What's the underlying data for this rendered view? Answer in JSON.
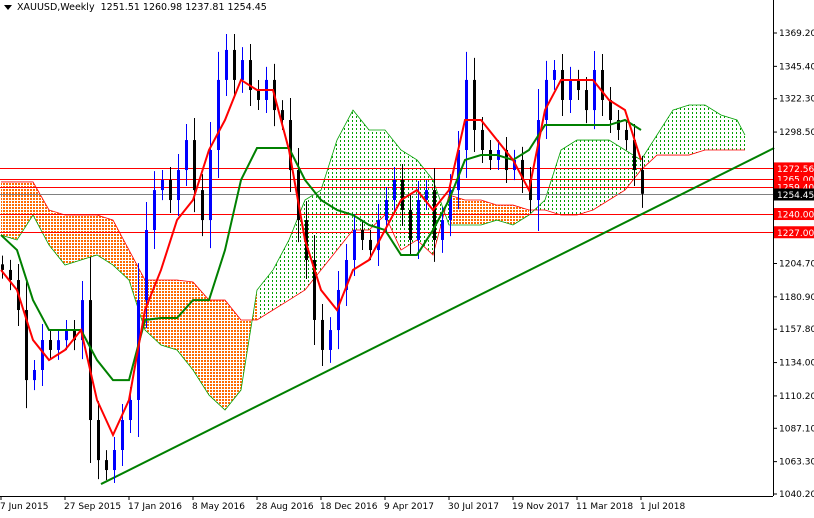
{
  "header": {
    "symbol": "XAUUSD,Weekly",
    "ohlc": "1251.51 1260.98 1237.81 1254.45"
  },
  "chart_data": {
    "type": "candlestick",
    "symbol": "XAUUSD",
    "timeframe": "Weekly",
    "ylim": [
      1040.2,
      1369.2
    ],
    "grid": false,
    "colors": {
      "up": "#0000ff",
      "down": "#000000",
      "tenkan": "#ff0000",
      "kijun": "#008000",
      "cloud_bull": "#00a000",
      "cloud_bear": "#ff6a00",
      "trendline": "#008000",
      "level": "#ff0000",
      "current": "#808080"
    },
    "x_ticks": [
      {
        "date": "2015-06-07",
        "label": "7 Jun 2015"
      },
      {
        "date": "2015-09-27",
        "label": "27 Sep 2015"
      },
      {
        "date": "2016-01-17",
        "label": "17 Jan 2016"
      },
      {
        "date": "2016-05-08",
        "label": "8 May 2016"
      },
      {
        "date": "2016-08-28",
        "label": "28 Aug 2016"
      },
      {
        "date": "2016-12-18",
        "label": "18 Dec 2016"
      },
      {
        "date": "2017-04-09",
        "label": "9 Apr 2017"
      },
      {
        "date": "2017-07-30",
        "label": "30 Jul 2017"
      },
      {
        "date": "2017-11-19",
        "label": "19 Nov 2017"
      },
      {
        "date": "2018-03-11",
        "label": "11 Mar 2018"
      },
      {
        "date": "2018-07-01",
        "label": "1 Jul 2018"
      }
    ],
    "y_ticks": [
      "1369.20",
      "1345.40",
      "1322.30",
      "1298.50",
      "1204.70",
      "1180.90",
      "1157.80",
      "1134.00",
      "1110.20",
      "1087.10",
      "1063.30",
      "1040.20"
    ],
    "levels": [
      {
        "price": 1272.56,
        "label": "1272.56"
      },
      {
        "price": 1265.0,
        "label": "1265.00"
      },
      {
        "price": 1259.4,
        "label": "1259.40"
      },
      {
        "price": 1240.0,
        "label": "1240.00"
      },
      {
        "price": 1227.0,
        "label": "1227.00"
      }
    ],
    "current_price": {
      "price": 1254.45,
      "label": "1254.45"
    },
    "trendline": [
      [
        "2015-11-29",
        1047.3
      ],
      [
        "2019-02-19",
        1287.1
      ]
    ],
    "candles": [
      [
        "2015-06-07",
        1200.1
      ],
      [
        "2015-06-21",
        1192.9
      ],
      [
        "2015-07-05",
        1171.5
      ],
      [
        "2015-07-19",
        1121.5
      ],
      [
        "2015-08-02",
        1128.7
      ],
      [
        "2015-08-16",
        1150.1
      ],
      [
        "2015-08-30",
        1143.0
      ],
      [
        "2015-09-13",
        1150.0
      ],
      [
        "2015-09-27",
        1157.2
      ],
      [
        "2015-10-11",
        1150.0
      ],
      [
        "2015-10-25",
        1178.6
      ],
      [
        "2015-11-08",
        1093.0
      ],
      [
        "2015-11-22",
        1064.4
      ],
      [
        "2015-12-06",
        1057.3
      ],
      [
        "2015-12-20",
        1071.6
      ],
      [
        "2016-01-03",
        1093.0
      ],
      [
        "2016-01-17",
        1107.3
      ],
      [
        "2016-01-31",
        1178.6
      ],
      [
        "2016-02-14",
        1228.6
      ],
      [
        "2016-02-28",
        1257.1
      ],
      [
        "2016-03-13",
        1264.3
      ],
      [
        "2016-03-27",
        1250.0
      ],
      [
        "2016-04-10",
        1271.4
      ],
      [
        "2016-04-24",
        1292.8
      ],
      [
        "2016-05-08",
        1257.1
      ],
      [
        "2016-05-22",
        1235.7
      ],
      [
        "2016-06-05",
        1285.7
      ],
      [
        "2016-06-19",
        1335.7
      ],
      [
        "2016-07-03",
        1357.1
      ],
      [
        "2016-07-17",
        1335.7
      ],
      [
        "2016-07-31",
        1349.9
      ],
      [
        "2016-08-14",
        1328.5
      ],
      [
        "2016-08-28",
        1321.4
      ],
      [
        "2016-09-11",
        1335.7
      ],
      [
        "2016-09-25",
        1314.2
      ],
      [
        "2016-10-09",
        1307.1
      ],
      [
        "2016-10-23",
        1271.4
      ],
      [
        "2016-11-06",
        1235.7
      ],
      [
        "2016-11-20",
        1207.2
      ],
      [
        "2016-12-04",
        1164.4
      ],
      [
        "2016-12-18",
        1143.0
      ],
      [
        "2017-01-01",
        1157.2
      ],
      [
        "2017-01-15",
        1185.8
      ],
      [
        "2017-01-29",
        1207.2
      ],
      [
        "2017-02-12",
        1228.6
      ],
      [
        "2017-02-26",
        1221.5
      ],
      [
        "2017-03-12",
        1214.3
      ],
      [
        "2017-03-26",
        1235.7
      ],
      [
        "2017-04-09",
        1250.0
      ],
      [
        "2017-04-23",
        1264.3
      ],
      [
        "2017-05-07",
        1242.9
      ],
      [
        "2017-05-21",
        1221.5
      ],
      [
        "2017-06-04",
        1250.0
      ],
      [
        "2017-06-18",
        1257.1
      ],
      [
        "2017-07-02",
        1221.5
      ],
      [
        "2017-07-16",
        1235.7
      ],
      [
        "2017-07-30",
        1257.1
      ],
      [
        "2017-08-13",
        1285.7
      ],
      [
        "2017-08-27",
        1335.7
      ],
      [
        "2017-09-10",
        1300.0
      ],
      [
        "2017-09-24",
        1285.7
      ],
      [
        "2017-10-08",
        1278.6
      ],
      [
        "2017-10-22",
        1285.7
      ],
      [
        "2017-11-05",
        1271.4
      ],
      [
        "2017-11-19",
        1278.6
      ],
      [
        "2017-12-03",
        1264.3
      ],
      [
        "2017-12-17",
        1250.0
      ],
      [
        "2017-12-31",
        1307.1
      ],
      [
        "2018-01-14",
        1335.7
      ],
      [
        "2018-01-28",
        1342.8
      ],
      [
        "2018-02-11",
        1321.4
      ],
      [
        "2018-02-25",
        1335.7
      ],
      [
        "2018-03-11",
        1328.5
      ],
      [
        "2018-03-25",
        1314.2
      ],
      [
        "2018-04-08",
        1342.8
      ],
      [
        "2018-04-22",
        1321.4
      ],
      [
        "2018-05-06",
        1307.1
      ],
      [
        "2018-05-20",
        1300.0
      ],
      [
        "2018-06-03",
        1292.8
      ],
      [
        "2018-06-17",
        1271.4
      ],
      [
        "2018-07-01",
        1254.45
      ]
    ],
    "tenkan": [
      [
        "2015-06-07",
        1200.1
      ],
      [
        "2015-07-05",
        1185.8
      ],
      [
        "2015-08-02",
        1150.1
      ],
      [
        "2015-08-30",
        1135.8
      ],
      [
        "2015-09-27",
        1143.0
      ],
      [
        "2015-10-25",
        1157.2
      ],
      [
        "2015-11-22",
        1107.3
      ],
      [
        "2015-12-20",
        1082.3
      ],
      [
        "2016-01-17",
        1107.3
      ],
      [
        "2016-02-14",
        1171.5
      ],
      [
        "2016-03-13",
        1200.1
      ],
      [
        "2016-04-10",
        1235.7
      ],
      [
        "2016-05-08",
        1250.0
      ],
      [
        "2016-06-05",
        1285.7
      ],
      [
        "2016-07-03",
        1307.1
      ],
      [
        "2016-07-31",
        1335.7
      ],
      [
        "2016-08-28",
        1328.5
      ],
      [
        "2016-09-25",
        1328.5
      ],
      [
        "2016-10-23",
        1285.7
      ],
      [
        "2016-11-20",
        1221.5
      ],
      [
        "2016-12-18",
        1185.8
      ],
      [
        "2017-01-15",
        1171.5
      ],
      [
        "2017-02-12",
        1200.1
      ],
      [
        "2017-03-12",
        1207.2
      ],
      [
        "2017-04-09",
        1228.6
      ],
      [
        "2017-05-07",
        1250.0
      ],
      [
        "2017-06-04",
        1257.1
      ],
      [
        "2017-07-02",
        1242.9
      ],
      [
        "2017-07-30",
        1257.1
      ],
      [
        "2017-08-27",
        1307.1
      ],
      [
        "2017-09-24",
        1307.1
      ],
      [
        "2017-10-22",
        1292.8
      ],
      [
        "2017-11-19",
        1278.6
      ],
      [
        "2017-12-17",
        1257.1
      ],
      [
        "2018-01-14",
        1314.2
      ],
      [
        "2018-02-11",
        1335.7
      ],
      [
        "2018-03-11",
        1335.7
      ],
      [
        "2018-04-08",
        1335.7
      ],
      [
        "2018-05-06",
        1321.4
      ],
      [
        "2018-06-03",
        1314.2
      ],
      [
        "2018-07-01",
        1278.6
      ]
    ],
    "kijun": [
      [
        "2015-06-07",
        1225.0
      ],
      [
        "2015-07-05",
        1214.3
      ],
      [
        "2015-08-02",
        1178.6
      ],
      [
        "2015-08-30",
        1157.2
      ],
      [
        "2015-09-27",
        1157.2
      ],
      [
        "2015-10-25",
        1157.2
      ],
      [
        "2015-11-22",
        1135.8
      ],
      [
        "2015-12-20",
        1121.5
      ],
      [
        "2016-01-17",
        1121.5
      ],
      [
        "2016-02-14",
        1164.4
      ],
      [
        "2016-03-13",
        1165.8
      ],
      [
        "2016-04-10",
        1165.8
      ],
      [
        "2016-05-08",
        1178.6
      ],
      [
        "2016-06-05",
        1178.6
      ],
      [
        "2016-07-03",
        1214.3
      ],
      [
        "2016-07-31",
        1264.3
      ],
      [
        "2016-08-28",
        1287.1
      ],
      [
        "2016-09-25",
        1287.1
      ],
      [
        "2016-10-23",
        1287.1
      ],
      [
        "2016-11-20",
        1264.3
      ],
      [
        "2016-12-18",
        1250.0
      ],
      [
        "2017-01-15",
        1242.9
      ],
      [
        "2017-02-12",
        1239.3
      ],
      [
        "2017-03-12",
        1232.2
      ],
      [
        "2017-04-09",
        1228.6
      ],
      [
        "2017-05-07",
        1210.8
      ],
      [
        "2017-06-04",
        1210.8
      ],
      [
        "2017-07-02",
        1228.6
      ],
      [
        "2017-07-30",
        1250.0
      ],
      [
        "2017-08-27",
        1278.6
      ],
      [
        "2017-09-24",
        1282.1
      ],
      [
        "2017-10-22",
        1282.1
      ],
      [
        "2017-11-19",
        1278.6
      ],
      [
        "2017-12-17",
        1285.7
      ],
      [
        "2018-01-14",
        1303.5
      ],
      [
        "2018-02-11",
        1303.5
      ],
      [
        "2018-03-11",
        1303.5
      ],
      [
        "2018-04-08",
        1303.5
      ],
      [
        "2018-05-06",
        1303.5
      ],
      [
        "2018-06-03",
        1307.1
      ],
      [
        "2018-07-01",
        1300.0
      ]
    ],
    "cloud": [
      [
        "2015-06-07",
        1225.0,
        1262.9
      ],
      [
        "2015-07-05",
        1221.5,
        1262.9
      ],
      [
        "2015-08-02",
        1239.3,
        1262.9
      ],
      [
        "2015-08-30",
        1217.9,
        1242.9
      ],
      [
        "2015-09-27",
        1203.6,
        1239.3
      ],
      [
        "2015-10-25",
        1207.2,
        1239.3
      ],
      [
        "2015-11-22",
        1210.8,
        1239.3
      ],
      [
        "2015-12-20",
        1203.6,
        1235.7
      ],
      [
        "2016-01-17",
        1192.9,
        1214.3
      ],
      [
        "2016-02-14",
        1157.2,
        1192.9
      ],
      [
        "2016-03-13",
        1146.5,
        1192.9
      ],
      [
        "2016-04-10",
        1143.0,
        1192.9
      ],
      [
        "2016-05-08",
        1128.7,
        1191.5
      ],
      [
        "2016-06-05",
        1110.8,
        1178.6
      ],
      [
        "2016-07-03",
        1100.1,
        1178.6
      ],
      [
        "2016-07-31",
        1114.4,
        1164.4
      ],
      [
        "2016-08-28",
        1185.8,
        1164.4
      ],
      [
        "2016-09-25",
        1200.1,
        1171.5
      ],
      [
        "2016-10-23",
        1221.5,
        1178.6
      ],
      [
        "2016-11-20",
        1250.0,
        1185.8
      ],
      [
        "2016-12-18",
        1257.1,
        1200.1
      ],
      [
        "2017-01-15",
        1292.8,
        1214.3
      ],
      [
        "2017-02-12",
        1314.2,
        1228.6
      ],
      [
        "2017-03-12",
        1300.0,
        1228.6
      ],
      [
        "2017-04-09",
        1300.0,
        1239.3
      ],
      [
        "2017-05-07",
        1285.7,
        1214.3
      ],
      [
        "2017-06-04",
        1278.6,
        1221.5
      ],
      [
        "2017-07-02",
        1264.3,
        1210.8
      ],
      [
        "2017-07-30",
        1232.2,
        1253.6
      ],
      [
        "2017-08-27",
        1232.2,
        1250.0
      ],
      [
        "2017-09-24",
        1232.2,
        1250.0
      ],
      [
        "2017-10-22",
        1235.7,
        1246.4
      ],
      [
        "2017-11-19",
        1232.2,
        1246.4
      ],
      [
        "2017-12-17",
        1239.3,
        1242.9
      ],
      [
        "2018-01-14",
        1250.0,
        1242.9
      ],
      [
        "2018-02-11",
        1285.7,
        1239.3
      ],
      [
        "2018-03-11",
        1292.8,
        1239.3
      ],
      [
        "2018-04-08",
        1292.8,
        1242.9
      ],
      [
        "2018-05-06",
        1292.8,
        1250.0
      ],
      [
        "2018-06-03",
        1285.7,
        1257.1
      ],
      [
        "2018-07-01",
        1278.6,
        1271.4
      ],
      [
        "2018-07-29",
        1296.4,
        1282.1
      ],
      [
        "2018-08-26",
        1314.2,
        1282.1
      ],
      [
        "2018-09-23",
        1317.8,
        1282.1
      ],
      [
        "2018-10-21",
        1317.8,
        1285.7
      ],
      [
        "2018-11-18",
        1310.7,
        1285.7
      ],
      [
        "2018-12-16",
        1307.1,
        1285.7
      ],
      [
        "2018-12-30",
        1296.4,
        1285.7
      ]
    ]
  }
}
